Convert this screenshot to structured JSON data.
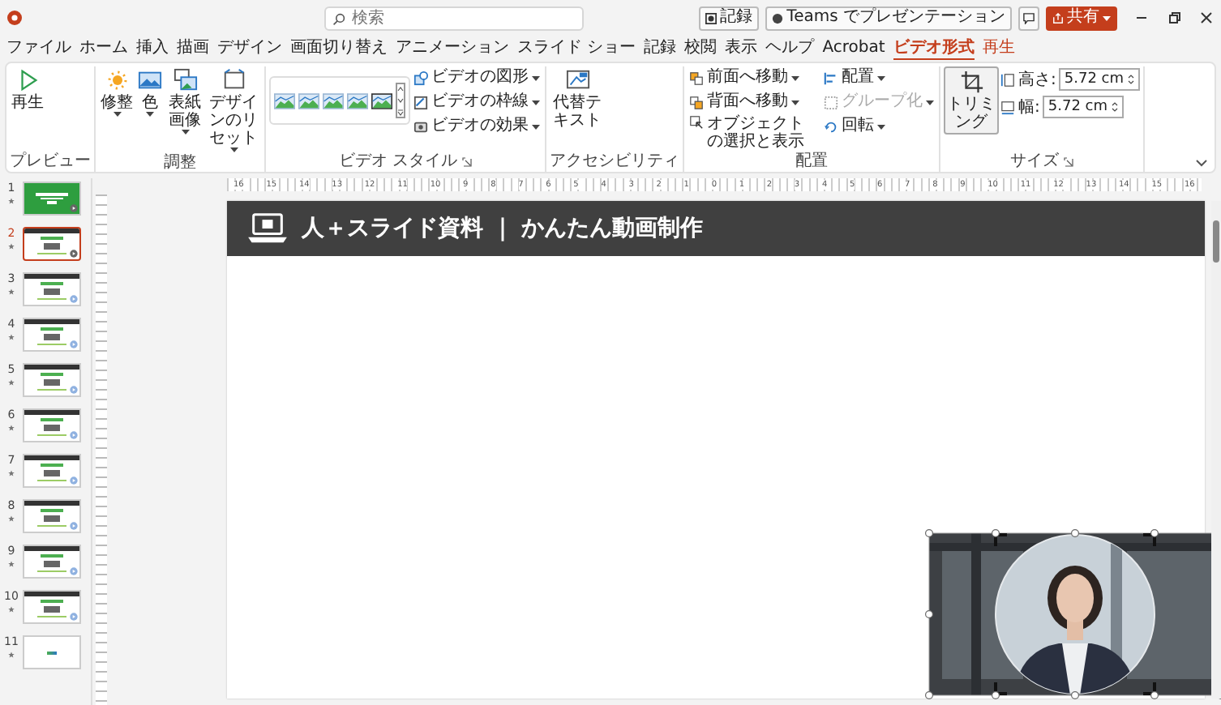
{
  "search": {
    "placeholder": "検索"
  },
  "header_buttons": [
    {
      "kind": "record",
      "label": "記録"
    },
    {
      "kind": "teams",
      "label": "Teams でプレゼンテーション"
    },
    {
      "kind": "comment"
    },
    {
      "kind": "share",
      "label": "共有"
    }
  ],
  "tabs": [
    {
      "label": "ファイル",
      "selected": false,
      "contextual": false
    },
    {
      "label": "ホーム",
      "selected": false,
      "contextual": false
    },
    {
      "label": "挿入",
      "selected": false,
      "contextual": false
    },
    {
      "label": "描画",
      "selected": false,
      "contextual": false
    },
    {
      "label": "デザイン",
      "selected": false,
      "contextual": false
    },
    {
      "label": "画面切り替え",
      "selected": false,
      "contextual": false
    },
    {
      "label": "アニメーション",
      "selected": false,
      "contextual": false
    },
    {
      "label": "スライド ショー",
      "selected": false,
      "contextual": false
    },
    {
      "label": "記録",
      "selected": false,
      "contextual": false
    },
    {
      "label": "校閲",
      "selected": false,
      "contextual": false
    },
    {
      "label": "表示",
      "selected": false,
      "contextual": false
    },
    {
      "label": "ヘルプ",
      "selected": false,
      "contextual": false
    },
    {
      "label": "Acrobat",
      "selected": false,
      "contextual": false
    },
    {
      "label": "ビデオ形式",
      "selected": true,
      "contextual": true
    },
    {
      "label": "再生",
      "selected": false,
      "contextual": true
    }
  ],
  "ribbon": [
    {
      "kind": "preview",
      "label": "プレビュー",
      "launcher": false,
      "buttons": [
        {
          "label": "再生",
          "dropdown": false,
          "disabled": false
        }
      ]
    },
    {
      "kind": "adjust",
      "label": "調整",
      "launcher": false,
      "buttons": [
        {
          "label": "修整",
          "dropdown": true,
          "disabled": false
        },
        {
          "label": "色",
          "dropdown": true,
          "disabled": false
        },
        {
          "label": "表紙画像",
          "dropdown": true,
          "disabled": false
        },
        {
          "label": "デザインのリセット",
          "dropdown": true,
          "disabled": false
        }
      ]
    },
    {
      "kind": "styles",
      "label": "ビデオ スタイル",
      "launcher": true,
      "buttons": [
        {
          "label": "ビデオの図形",
          "dropdown": true,
          "disabled": false
        },
        {
          "label": "ビデオの枠線",
          "dropdown": true,
          "disabled": false
        },
        {
          "label": "ビデオの効果",
          "dropdown": true,
          "disabled": false
        }
      ]
    },
    {
      "kind": "accessibility",
      "label": "アクセシビリティ",
      "launcher": false,
      "buttons": [
        {
          "label": "代替テキスト",
          "dropdown": false,
          "disabled": false
        }
      ]
    },
    {
      "kind": "arrange",
      "label": "配置",
      "launcher": false,
      "buttons": [
        {
          "label": "前面へ移動",
          "dropdown": true,
          "disabled": false
        },
        {
          "label": "背面へ移動",
          "dropdown": true,
          "disabled": false
        },
        {
          "label": "オブジェクトの選択と表示",
          "dropdown": false,
          "disabled": false
        },
        {
          "label": "配置",
          "dropdown": true,
          "disabled": false
        },
        {
          "label": "グループ化",
          "dropdown": true,
          "disabled": true
        },
        {
          "label": "回転",
          "dropdown": true,
          "disabled": false
        }
      ]
    },
    {
      "kind": "size",
      "label": "サイズ",
      "launcher": true,
      "buttons": [
        {
          "label": "トリミング",
          "dropdown": false,
          "disabled": false
        }
      ],
      "fields": [
        {
          "label": "高さ:",
          "value": "5.72 cm"
        },
        {
          "label": "幅:",
          "value": "5.72 cm"
        }
      ]
    }
  ],
  "ruler": [
    "16",
    "15",
    "14",
    "13",
    "12",
    "11",
    "10",
    "9",
    "8",
    "7",
    "6",
    "5",
    "4",
    "3",
    "2",
    "1",
    "0",
    "1",
    "2",
    "3",
    "4",
    "5",
    "6",
    "7",
    "8",
    "9",
    "10",
    "11",
    "12",
    "13",
    "14",
    "15",
    "16"
  ],
  "slides": [
    {
      "number": "1",
      "kind": "title",
      "selected": false,
      "media": true
    },
    {
      "number": "2",
      "kind": "content",
      "selected": true,
      "media": true
    },
    {
      "number": "3",
      "kind": "content",
      "selected": false,
      "media": true
    },
    {
      "number": "4",
      "kind": "content",
      "selected": false,
      "media": true
    },
    {
      "number": "5",
      "kind": "content",
      "selected": false,
      "media": true
    },
    {
      "number": "6",
      "kind": "content",
      "selected": false,
      "media": true
    },
    {
      "number": "7",
      "kind": "content",
      "selected": false,
      "media": true
    },
    {
      "number": "8",
      "kind": "content",
      "selected": false,
      "media": true
    },
    {
      "number": "9",
      "kind": "content",
      "selected": false,
      "media": true
    },
    {
      "number": "10",
      "kind": "content",
      "selected": false,
      "media": true
    },
    {
      "number": "11",
      "kind": "end",
      "selected": false,
      "media": false
    }
  ],
  "slide": {
    "title": "人＋スライド資料 ｜ かんたん動画制作",
    "video": {
      "kind": "picture",
      "selected": true
    }
  }
}
